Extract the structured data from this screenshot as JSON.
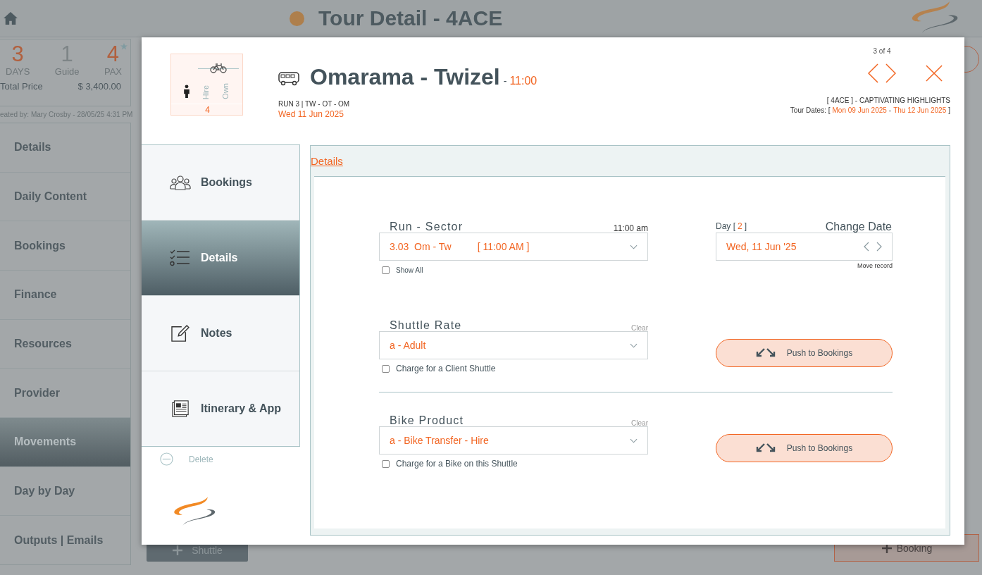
{
  "header": {
    "title": "Tour Detail - 4ACE"
  },
  "summary": {
    "days": "3",
    "days_label": "DAYS",
    "guide": "1",
    "guide_label": "Guide",
    "pax": "4",
    "pax_label": "PAX",
    "total_label": "Total Price",
    "total": "$ 3,400.00"
  },
  "created_by": "eated by: Mary Crosby - 28/05/25 4:31 PM",
  "nav": [
    {
      "label": "Details",
      "selected": false
    },
    {
      "label": "Daily Content",
      "selected": false
    },
    {
      "label": "Bookings",
      "selected": false
    },
    {
      "label": "Finance",
      "selected": false
    },
    {
      "label": "Resources",
      "selected": false
    },
    {
      "label": "Provider",
      "selected": false
    },
    {
      "label": "Movements",
      "selected": true
    },
    {
      "label": "Day by Day",
      "selected": false
    },
    {
      "label": "Outputs | Emails",
      "selected": false
    }
  ],
  "bottom_buttons": {
    "shuttle": "Shuttle",
    "booking": "Booking"
  },
  "modal": {
    "pax_box": {
      "hire_label": "Hire",
      "own_label": "Own",
      "count": "4"
    },
    "counter": "3 of 4",
    "title": "Omarama - Twizel",
    "time_sep": "-",
    "time": "11:00",
    "run_info": "RUN 3 | TW - OT - OM",
    "date": "Wed 11 Jun 2025",
    "tour_name": "[ 4ACE ] - CAPTIVATING HIGHLIGHTS",
    "tour_dates": {
      "label": "Tour Dates: [",
      "start": "Mon 09 Jun 2025",
      "sep": "-",
      "end": "Thu 12 Jun 2025",
      "close": "]"
    },
    "tabs": [
      {
        "label": "Bookings",
        "kind": "people",
        "selected": false
      },
      {
        "label": "Details",
        "kind": "checklist",
        "selected": true
      },
      {
        "label": "Notes",
        "kind": "edit",
        "selected": false
      },
      {
        "label": "Itinerary & App",
        "kind": "document",
        "selected": false
      }
    ],
    "delete": "Delete",
    "section_title": "Details",
    "run_sector": {
      "label": "Run - Sector",
      "time": "11:00 am",
      "value": "3.03  Om - Tw",
      "value_time": "[ 11:00 AM ]",
      "show_all": {
        "label": "Show All",
        "checked": false
      }
    },
    "day": {
      "label": "Day [",
      "number": "2",
      "close": "]"
    },
    "change_date": {
      "label": "Change Date",
      "value": "Wed, 11 Jun '25",
      "note": "Move record"
    },
    "products": [
      {
        "label": "Shuttle Rate",
        "clear": "Clear",
        "value": "a - Adult",
        "checkbox": {
          "label": "Charge for a Client Shuttle",
          "checked": false
        },
        "push": "Push to Bookings"
      },
      {
        "label": "Bike Product",
        "clear": "Clear",
        "value": "a - Bike Transfer - Hire",
        "checkbox": {
          "label": "Charge for a Bike on this Shuttle",
          "checked": false
        },
        "push": "Push to Bookings"
      }
    ]
  }
}
